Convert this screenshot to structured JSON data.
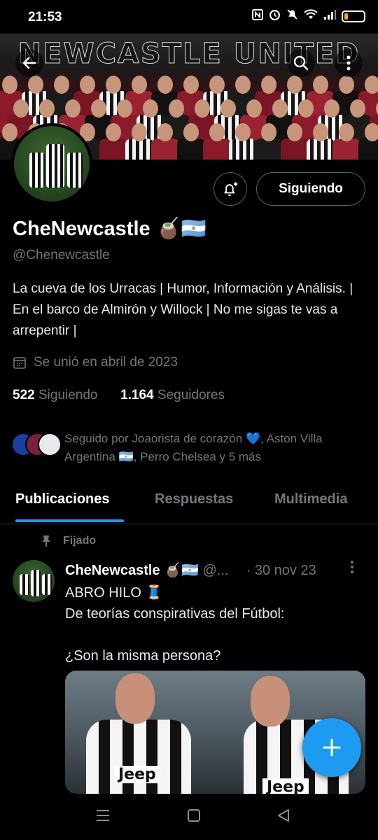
{
  "status_bar": {
    "time": "21:53",
    "icons": [
      "nfc-icon",
      "alarm-icon",
      "mute-icon",
      "wifi-icon",
      "signal-icon"
    ],
    "battery_level": 0.2
  },
  "banner": {
    "title": "NEWCASTLE UNITED"
  },
  "profile": {
    "name": "CheNewcastle 🧉🇦🇷",
    "handle": "@Chenewcastle",
    "follow_button": "Siguiendo",
    "bio": "La cueva de los Urracas | Humor, Información y Análisis. | En el barco de Almirón y Willock | No me sigas te vas a arrepentir |",
    "joined": "Se unió en abril de 2023",
    "following_count": "522",
    "following_label": "Siguiendo",
    "followers_count": "1.164",
    "followers_label": "Seguidores",
    "followed_by": "Seguido por Joaorista de corazón 💙, Aston Villa Argentina 🇦🇷, Perro Chelsea y 5 más"
  },
  "tabs": [
    {
      "label": "Publicaciones",
      "active": true
    },
    {
      "label": "Respuestas",
      "active": false
    },
    {
      "label": "Multimedia",
      "active": false
    }
  ],
  "pinned_post": {
    "pinned_label": "Fijado",
    "author": "CheNewcastle 🧉🇦🇷",
    "handle": "@...",
    "date": "· 30 nov 23",
    "text": "ABRO HILO 🧵\nDe teorías conspirativas del Fútbol:\n\n¿Son la misma persona?",
    "media_sponsor_left": "Jeep",
    "media_sponsor_right": "Jeep"
  },
  "colors": {
    "accent": "#1d9bf0",
    "secondary_text": "#71767b",
    "divider": "#2f3336"
  }
}
